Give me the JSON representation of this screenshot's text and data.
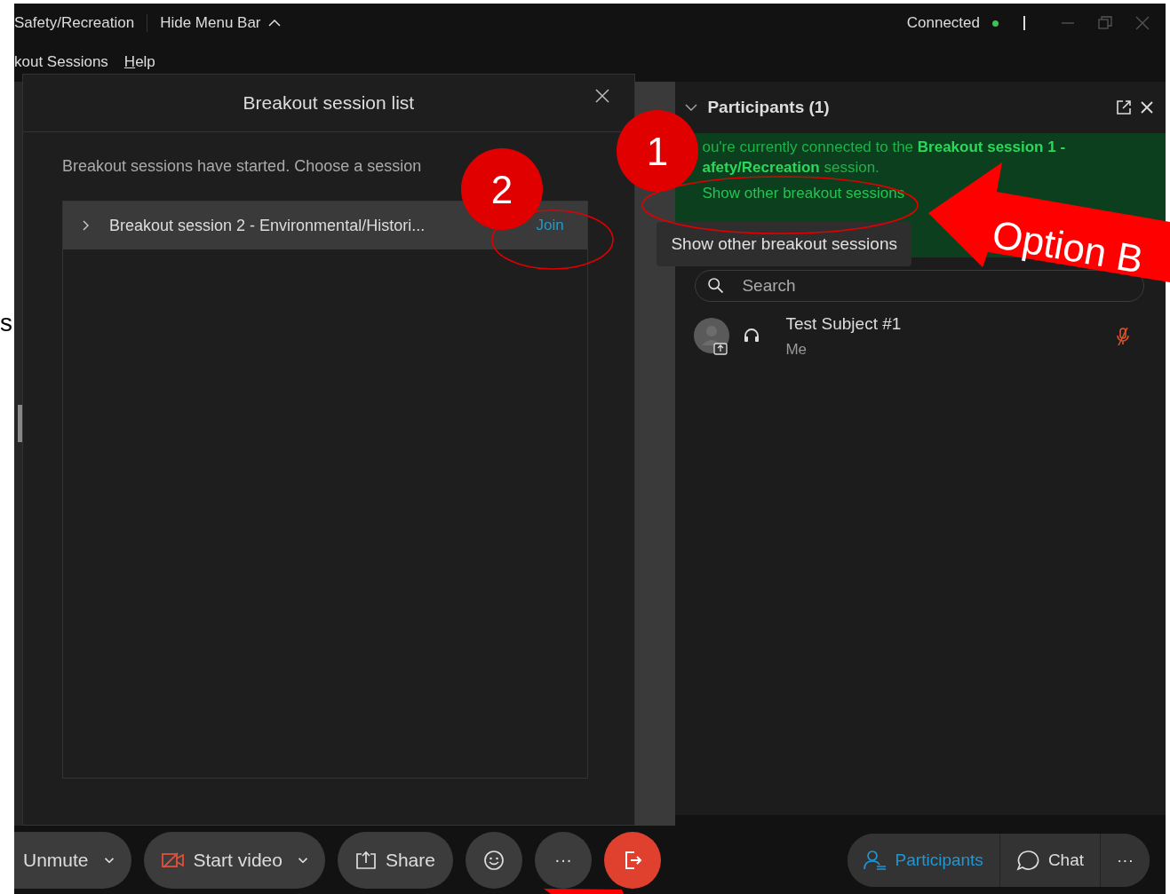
{
  "page_edge": {
    "text_fragment": "s"
  },
  "title_bar": {
    "meeting_name": "Safety/Recreation",
    "hide_menu_label": "Hide Menu Bar",
    "status": "Connected",
    "connected": true
  },
  "menu_bar": [
    {
      "label": "kout Sessions"
    },
    {
      "label": "Help"
    }
  ],
  "breakout_dialog": {
    "title": "Breakout session list",
    "message": "Breakout sessions have started. Choose a session",
    "sessions": [
      {
        "name": "Breakout session 2 - Environmental/Histori...",
        "expanded": false,
        "join_label": "Join"
      }
    ]
  },
  "participants_panel": {
    "title": "Participants (1)",
    "expanded": true,
    "banner": {
      "message": "ou're currently connected to the **Breakout session 1 - afety/Recreation** session.",
      "link": "Show other breakout sessions"
    },
    "tooltip": "Show other breakout sessions",
    "search": {
      "placeholder": "Search"
    },
    "participants": [
      {
        "name": "Test Subject #1",
        "subtitle": "Me",
        "muted": true
      }
    ]
  },
  "toolbar": {
    "left": [
      {
        "kind": "mute",
        "label": "Unmute",
        "dropdown": true
      },
      {
        "kind": "video",
        "label": "Start video",
        "dropdown": true
      },
      {
        "kind": "share",
        "label": "Share"
      },
      {
        "kind": "reactions"
      },
      {
        "kind": "more",
        "label": "···"
      },
      {
        "kind": "leave"
      }
    ],
    "right": [
      {
        "kind": "participants",
        "label": "Participants",
        "selected": true
      },
      {
        "kind": "chat",
        "label": "Chat",
        "selected": false
      },
      {
        "kind": "more",
        "label": "···",
        "selected": false
      }
    ]
  },
  "annotations": [
    {
      "kind": "badge",
      "label": "1"
    },
    {
      "kind": "badge",
      "label": "2"
    },
    {
      "kind": "ellipse"
    },
    {
      "kind": "ellipse"
    },
    {
      "kind": "arrow",
      "label": "Option B"
    },
    {
      "kind": "arrow"
    }
  ]
}
